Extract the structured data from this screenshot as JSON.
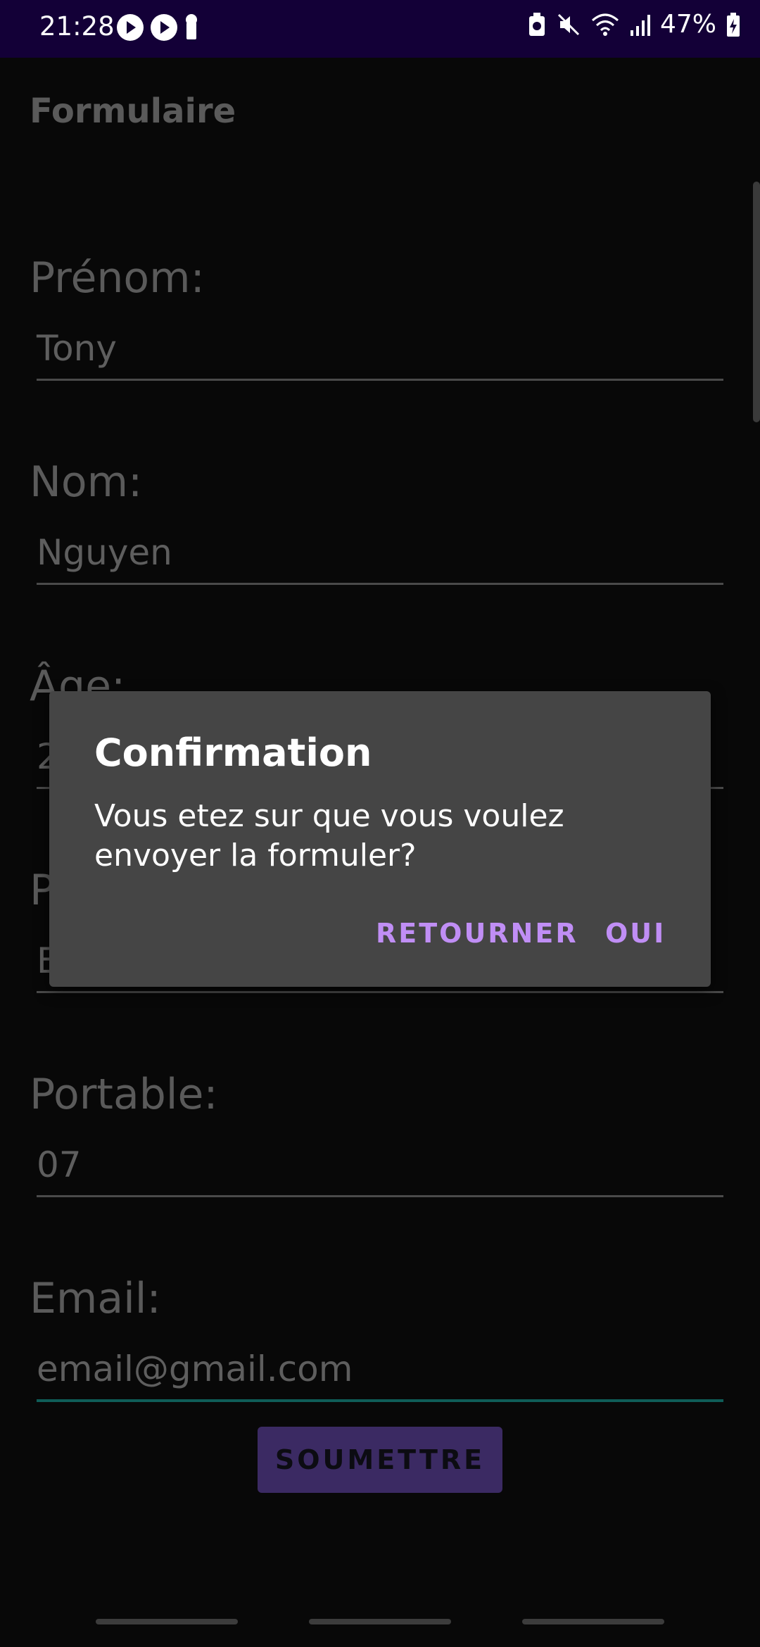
{
  "status_bar": {
    "time": "21:28",
    "battery": "47%",
    "icons": [
      "play-icon",
      "play-icon",
      "keyhole-icon",
      "battery-saver-icon",
      "mute-icon",
      "wifi-icon",
      "signal-icon",
      "battery-charging-icon"
    ]
  },
  "app": {
    "title": "Formulaire"
  },
  "form": {
    "prenom": {
      "label": "Prénom:",
      "value": "Tony"
    },
    "nom": {
      "label": "Nom:",
      "value": "Nguyen"
    },
    "age": {
      "label": "Âge:",
      "value": "2"
    },
    "hidden_field": {
      "label": "P",
      "value": "E"
    },
    "portable": {
      "label": "Portable:",
      "value": "07"
    },
    "email": {
      "label": "Email:",
      "value": "email@gmail.com"
    },
    "submit_label": "SOUMETTRE"
  },
  "dialog": {
    "title": "Confirmation",
    "message": "Vous etez sur que vous voulez envoyer la formuler?",
    "negative_label": "RETOURNER",
    "positive_label": "OUI"
  },
  "colors": {
    "status_bar_bg": "#130037",
    "dialog_button": "#c08ef5",
    "submit_bg": "#3b2a63",
    "email_underline": "#0f5d58"
  }
}
